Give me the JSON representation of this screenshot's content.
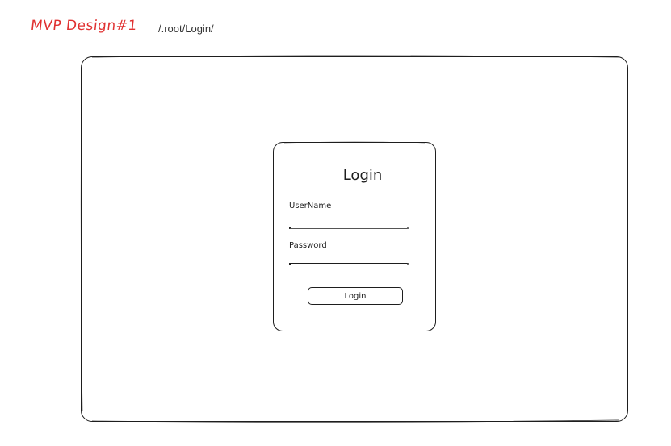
{
  "header": {
    "design_title": "MVP Design#1",
    "route_path": "/.root/Login/"
  },
  "login_card": {
    "title": "Login",
    "username_label": "UserName",
    "username_value": "",
    "password_label": "Password",
    "password_value": "",
    "button_label": "Login"
  },
  "colors": {
    "title_accent": "#e03131",
    "stroke": "#1e1e1e",
    "background": "#ffffff"
  }
}
